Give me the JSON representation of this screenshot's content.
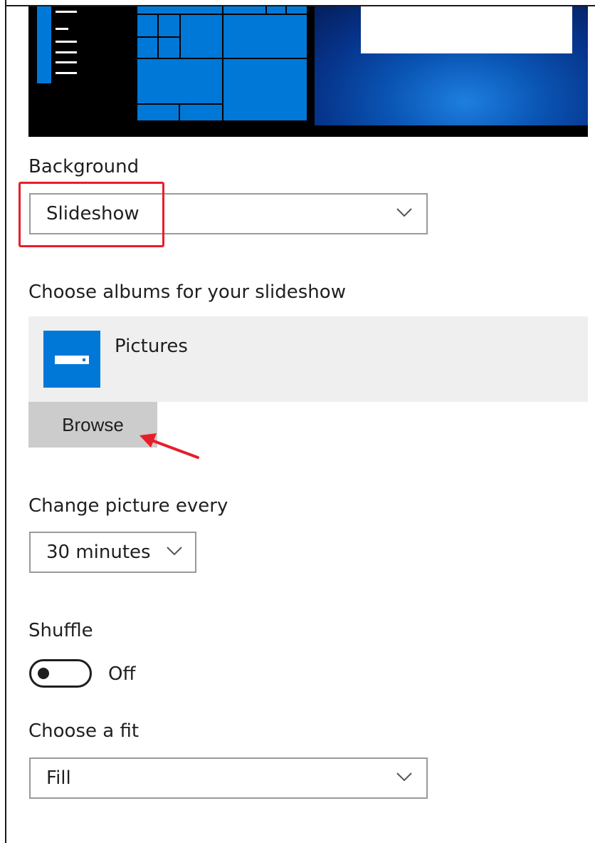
{
  "background": {
    "label": "Background",
    "value": "Slideshow"
  },
  "albums": {
    "label": "Choose albums for your slideshow",
    "album_name": "Pictures",
    "browse_label": "Browse"
  },
  "interval": {
    "label": "Change picture every",
    "value": "30 minutes"
  },
  "shuffle": {
    "label": "Shuffle",
    "state": "Off"
  },
  "fit": {
    "label": "Choose a fit",
    "value": "Fill"
  },
  "icons": {
    "dropdown": "chevron-down-icon",
    "album": "folder-icon",
    "annotation": "arrow-icon"
  },
  "colors": {
    "accent": "#0078d7",
    "annotation": "#e81d2a",
    "panel": "#efefef",
    "button": "#cccccc"
  }
}
